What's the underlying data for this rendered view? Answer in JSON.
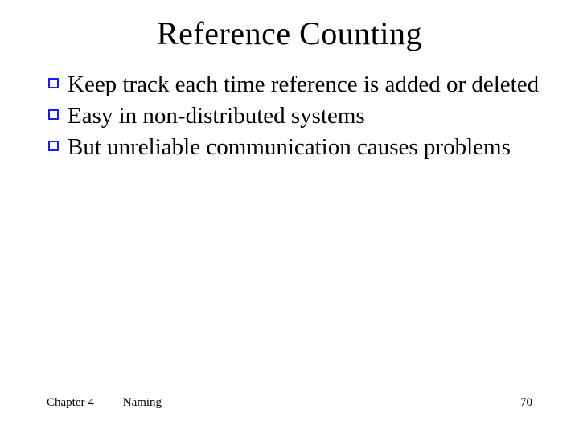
{
  "title": "Reference Counting",
  "bullets": [
    "Keep track each time reference is added or deleted",
    "Easy in non-distributed systems",
    "But unreliable communication causes problems"
  ],
  "footer": {
    "chapter_prefix": "Chapter 4",
    "chapter_name": "Naming",
    "page": "70"
  }
}
